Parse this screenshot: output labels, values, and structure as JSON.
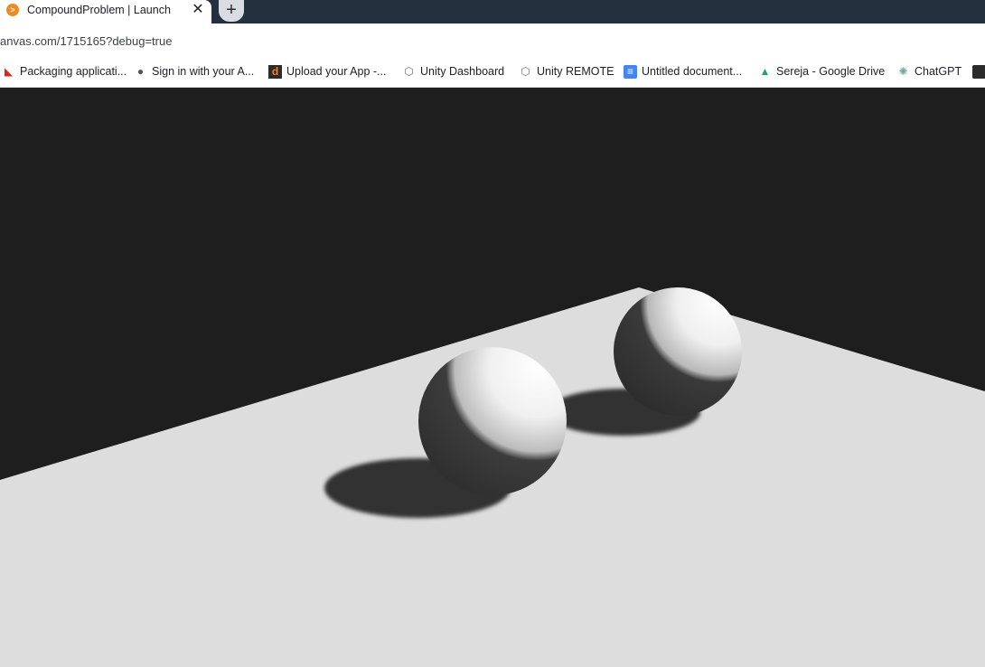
{
  "tab": {
    "title": "CompoundProblem | Launch",
    "favicon_symbol": ">",
    "close_symbol": "✕"
  },
  "new_tab_symbol": "+",
  "address_bar": {
    "url": "anvas.com/1715165?debug=true"
  },
  "bookmarks": [
    {
      "label": "Packaging applicati...",
      "icon": "adobe-icon",
      "symbol": "◣",
      "color": "#e2231a"
    },
    {
      "label": "Sign in with your A...",
      "icon": "apple-icon",
      "symbol": "●",
      "color": "#555555"
    },
    {
      "label": "Upload your App -...",
      "icon": "upload-d-icon",
      "symbol": "d",
      "color": "#f48120"
    },
    {
      "label": "Unity Dashboard",
      "icon": "unity-icon",
      "symbol": "⬡",
      "color": "#6d6d6d"
    },
    {
      "label": "Unity REMOTE",
      "icon": "unity-icon",
      "symbol": "⬡",
      "color": "#6d6d6d"
    },
    {
      "label": "Untitled document...",
      "icon": "google-docs-icon",
      "symbol": "≡",
      "color": "#4285f4"
    },
    {
      "label": "Sereja - Google Drive",
      "icon": "google-drive-icon",
      "symbol": "▲",
      "color": "#1fa463"
    },
    {
      "label": "ChatGPT",
      "icon": "chatgpt-icon",
      "symbol": "✺",
      "color": "#74aa9c"
    }
  ],
  "colors": {
    "background": "#1e1e1e",
    "floor": "#dddddd",
    "shadow": "#333333",
    "sphere_light": "#ffffff",
    "sphere_dark": "#343434"
  }
}
